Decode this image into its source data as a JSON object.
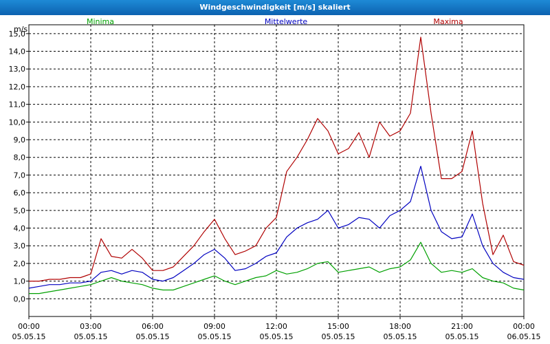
{
  "window": {
    "title": "Windgeschwindigkeit [m/s] skaliert"
  },
  "colors": {
    "title_bar": "#1478c8",
    "minima": "#00a000",
    "mittelwerte": "#0000c0",
    "maxima": "#b00000",
    "grid": "#000000"
  },
  "chart_data": {
    "type": "line",
    "ylabel": "m/s",
    "ylim": [
      -1,
      15.5
    ],
    "xlim": [
      0,
      24
    ],
    "grid": true,
    "legend_position": "top",
    "y_ticks": [
      {
        "v": 0,
        "label": "0,0"
      },
      {
        "v": 1,
        "label": "1,0"
      },
      {
        "v": 2,
        "label": "2,0"
      },
      {
        "v": 3,
        "label": "3,0"
      },
      {
        "v": 4,
        "label": "4,0"
      },
      {
        "v": 5,
        "label": "5,0"
      },
      {
        "v": 6,
        "label": "6,0"
      },
      {
        "v": 7,
        "label": "7,0"
      },
      {
        "v": 8,
        "label": "8,0"
      },
      {
        "v": 9,
        "label": "9,0"
      },
      {
        "v": 10,
        "label": "10,0"
      },
      {
        "v": 11,
        "label": "11,0"
      },
      {
        "v": 12,
        "label": "12,0"
      },
      {
        "v": 13,
        "label": "13,0"
      },
      {
        "v": 14,
        "label": "14,0"
      },
      {
        "v": 15,
        "label": "15,0"
      }
    ],
    "x_ticks": [
      {
        "h": 0,
        "time": "00:00",
        "date": "05.05.15"
      },
      {
        "h": 3,
        "time": "03:00",
        "date": "05.05.15"
      },
      {
        "h": 6,
        "time": "06:00",
        "date": "05.05.15"
      },
      {
        "h": 9,
        "time": "09:00",
        "date": "05.05.15"
      },
      {
        "h": 12,
        "time": "12:00",
        "date": "05.05.15"
      },
      {
        "h": 15,
        "time": "15:00",
        "date": "05.05.15"
      },
      {
        "h": 18,
        "time": "18:00",
        "date": "05.05.15"
      },
      {
        "h": 21,
        "time": "21:00",
        "date": "05.05.15"
      },
      {
        "h": 24,
        "time": "00:00",
        "date": "06.05.15"
      }
    ],
    "x": [
      0,
      0.5,
      1,
      1.5,
      2,
      2.5,
      3,
      3.5,
      4,
      4.5,
      5,
      5.5,
      6,
      6.5,
      7,
      7.5,
      8,
      8.5,
      9,
      9.5,
      10,
      10.5,
      11,
      11.5,
      12,
      12.5,
      13,
      13.5,
      14,
      14.5,
      15,
      15.5,
      16,
      16.5,
      17,
      17.5,
      18,
      18.5,
      19,
      19.5,
      20,
      20.5,
      21,
      21.5,
      22,
      22.5,
      23,
      23.5,
      24
    ],
    "series": [
      {
        "name": "Minima",
        "values": [
          0.3,
          0.3,
          0.4,
          0.5,
          0.6,
          0.7,
          0.8,
          1.0,
          1.2,
          1.0,
          0.9,
          0.8,
          0.6,
          0.5,
          0.5,
          0.7,
          0.9,
          1.1,
          1.3,
          1.0,
          0.8,
          1.0,
          1.2,
          1.3,
          1.6,
          1.4,
          1.5,
          1.7,
          2.0,
          2.1,
          1.5,
          1.6,
          1.7,
          1.8,
          1.5,
          1.7,
          1.8,
          2.2,
          3.2,
          2.0,
          1.5,
          1.6,
          1.5,
          1.7,
          1.2,
          1.0,
          0.9,
          0.6,
          0.5
        ]
      },
      {
        "name": "Mittelwerte",
        "values": [
          0.6,
          0.7,
          0.8,
          0.8,
          0.9,
          0.9,
          1.0,
          1.5,
          1.6,
          1.4,
          1.6,
          1.5,
          1.1,
          1.0,
          1.2,
          1.6,
          2.0,
          2.5,
          2.8,
          2.3,
          1.6,
          1.7,
          2.0,
          2.4,
          2.6,
          3.5,
          4.0,
          4.3,
          4.5,
          5.0,
          4.0,
          4.2,
          4.6,
          4.5,
          4.0,
          4.7,
          5.0,
          5.5,
          7.5,
          5.0,
          3.8,
          3.4,
          3.5,
          4.8,
          3.0,
          2.0,
          1.5,
          1.2,
          1.1
        ]
      },
      {
        "name": "Maxima",
        "values": [
          1.0,
          1.0,
          1.1,
          1.1,
          1.2,
          1.2,
          1.4,
          3.4,
          2.4,
          2.3,
          2.8,
          2.3,
          1.6,
          1.6,
          1.8,
          2.4,
          3.0,
          3.8,
          4.5,
          3.4,
          2.5,
          2.7,
          3.0,
          4.0,
          4.6,
          7.2,
          8.0,
          9.0,
          10.2,
          9.5,
          8.2,
          8.5,
          9.4,
          8.0,
          10.0,
          9.2,
          9.5,
          10.5,
          14.8,
          10.5,
          6.8,
          6.8,
          7.2,
          9.5,
          5.4,
          2.5,
          3.6,
          2.1,
          1.9
        ]
      }
    ]
  }
}
